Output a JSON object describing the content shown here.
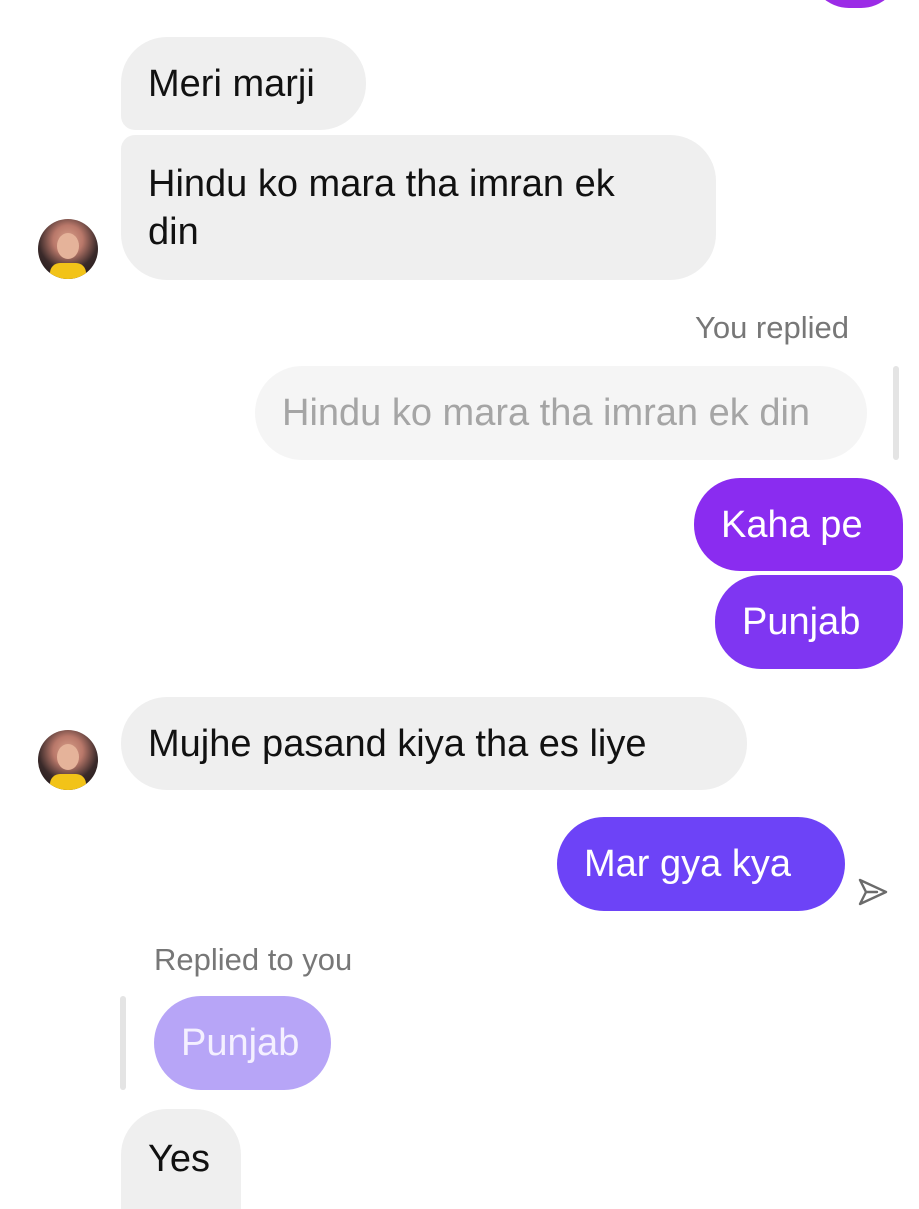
{
  "messages": {
    "m1": "Meri marji",
    "m2_line1": "Hindu ko mara tha imran ek",
    "m2_line2": "din",
    "reply_label": "You replied",
    "quoted_text": "Hindu ko mara tha imran ek din",
    "m3": "Kaha pe",
    "m4": "Punjab",
    "m5": "Mujhe pasand kiya tha es liye",
    "m6": "Mar gya kya",
    "replied_label": "Replied to you",
    "quoted_text_2": "Punjab",
    "m7": "Yes"
  },
  "colors": {
    "incoming_bubble": "#efefef",
    "outgoing_gradient_top": "#8c2cf0",
    "outgoing_gradient_bottom": "#6d43f7",
    "quoted_outgoing": "#b7a5f7"
  },
  "icons": {
    "avatar": "contact-avatar",
    "send_status": "paper-plane-outline-icon"
  }
}
